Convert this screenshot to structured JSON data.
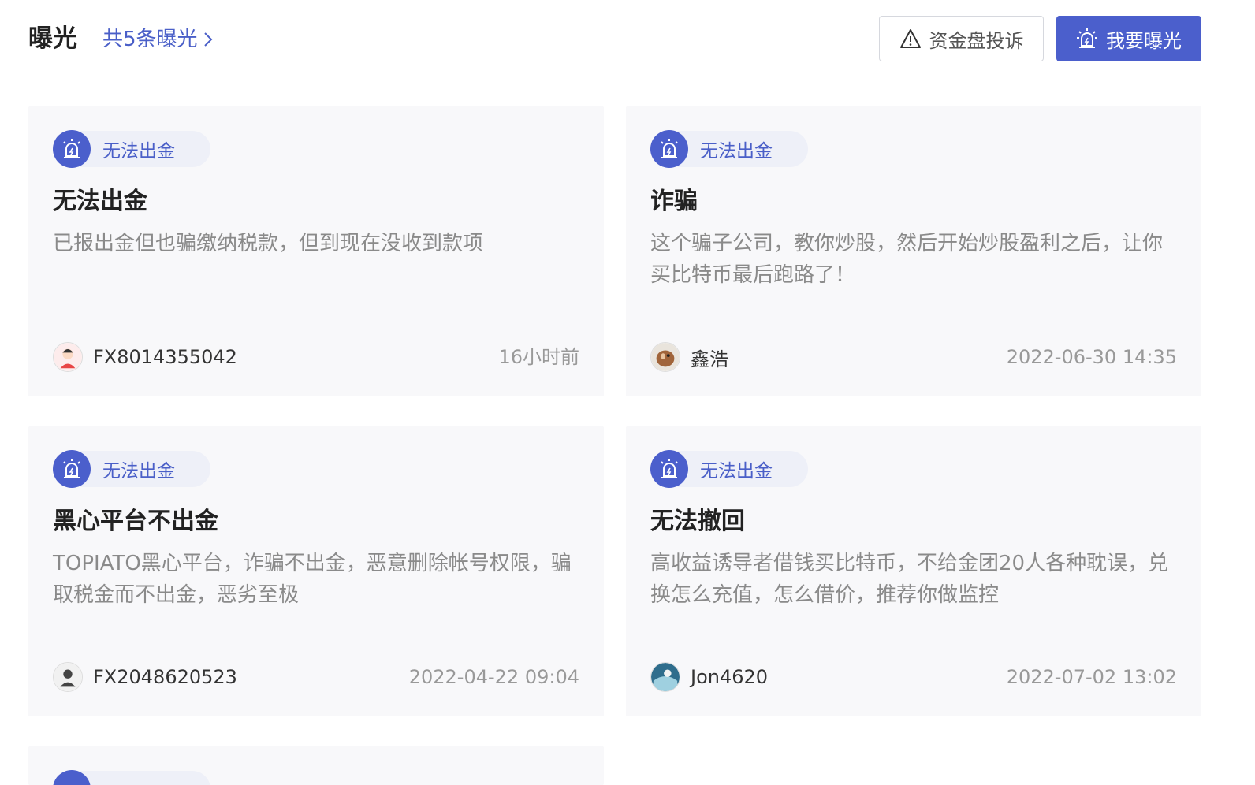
{
  "header": {
    "title": "曝光",
    "count_link": "共5条曝光",
    "complaint_button": "资金盘投诉",
    "expose_button": "我要曝光"
  },
  "cards": [
    {
      "tag": "无法出金",
      "title": "无法出金",
      "description": "已报出金但也骗缴纳税款，但到现在没收到款项",
      "author": "FX8014355042",
      "time": "16小时前"
    },
    {
      "tag": "无法出金",
      "title": "诈骗",
      "description": "这个骗子公司，教你炒股，然后开始炒股盈利之后，让你买比特币最后跑路了！",
      "author": "鑫浩",
      "time": "2022-06-30 14:35"
    },
    {
      "tag": "无法出金",
      "title": "黑心平台不出金",
      "description": "TOPIATO黑心平台，诈骗不出金，恶意删除帐号权限，骗取税金而不出金，恶劣至极",
      "author": "FX2048620523",
      "time": "2022-04-22 09:04"
    },
    {
      "tag": "无法出金",
      "title": "无法撤回",
      "description": "高收益诱导者借钱买比特币，不给金团20人各种耽误，兑换怎么充值，怎么借价，推荐你做监控",
      "author": "Jon4620",
      "time": "2022-07-02 13:02"
    }
  ],
  "colors": {
    "accent": "#4b5fcc",
    "card_bg": "#f8f8fa"
  }
}
